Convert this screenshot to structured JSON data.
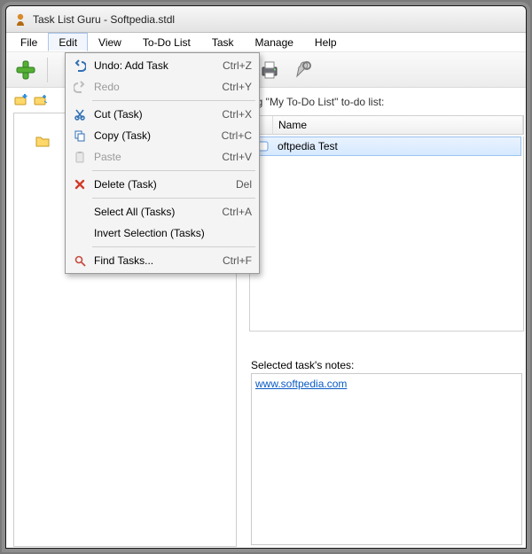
{
  "window": {
    "title": "Task List Guru - Softpedia.stdl"
  },
  "menubar": [
    "File",
    "Edit",
    "View",
    "To-Do List",
    "Task",
    "Manage",
    "Help"
  ],
  "menubar_active_index": 1,
  "edit_menu": {
    "undo": {
      "label": "Undo: Add Task",
      "accel": "Ctrl+Z",
      "enabled": true
    },
    "redo": {
      "label": "Redo",
      "accel": "Ctrl+Y",
      "enabled": false
    },
    "cut": {
      "label": "Cut (Task)",
      "accel": "Ctrl+X",
      "enabled": true
    },
    "copy": {
      "label": "Copy (Task)",
      "accel": "Ctrl+C",
      "enabled": true
    },
    "paste": {
      "label": "Paste",
      "accel": "Ctrl+V",
      "enabled": false
    },
    "delete": {
      "label": "Delete (Task)",
      "accel": "Del",
      "enabled": true
    },
    "selectall": {
      "label": "Select All (Tasks)",
      "accel": "Ctrl+A",
      "enabled": true
    },
    "invert": {
      "label": "Invert Selection (Tasks)",
      "accel": "",
      "enabled": true
    },
    "find": {
      "label": "Find Tasks...",
      "accel": "Ctrl+F",
      "enabled": true
    }
  },
  "main": {
    "list_caption_prefix": "ng \"",
    "list_name": "My To-Do List",
    "list_caption_suffix": "\" to-do list:",
    "grid": {
      "columns": {
        "col1": "",
        "col2": "Name"
      },
      "rows": [
        {
          "name": "oftpedia Test",
          "visible_name": "oftpedia Test"
        }
      ]
    },
    "notes_label": "Selected task's notes:",
    "notes_link": "www.softpedia.com"
  }
}
